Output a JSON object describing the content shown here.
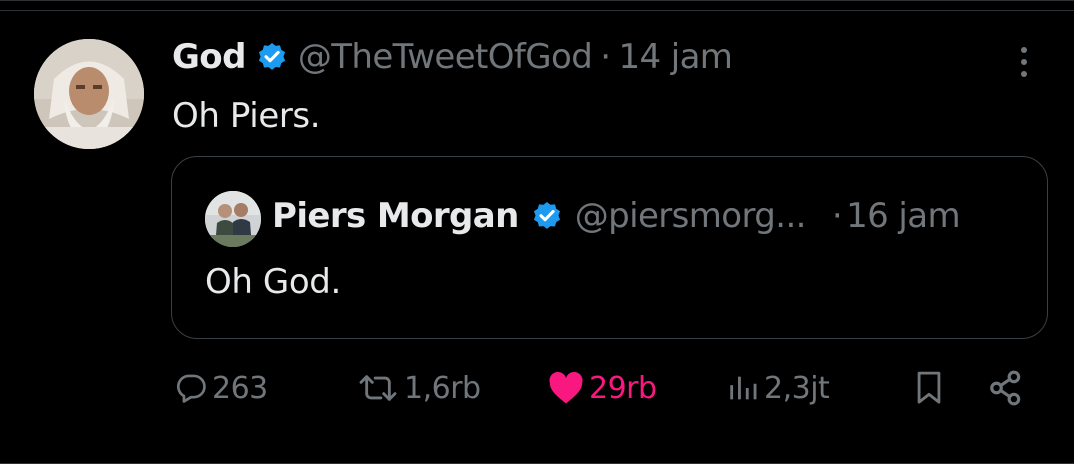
{
  "tweet": {
    "author_name": "God",
    "author_handle": "@TheTweetOfGod",
    "separator": "·",
    "time": "14 jam",
    "text": "Oh Piers.",
    "verified_color": "#1d9bf0"
  },
  "quoted_tweet": {
    "author_name": "Piers Morgan",
    "author_handle": "@piersmorg...",
    "separator": "·",
    "time": "16 jam",
    "text": "Oh God."
  },
  "actions": {
    "replies": "263",
    "reposts": "1,6rb",
    "likes": "29rb",
    "views": "2,3jt",
    "like_color": "#f91880"
  },
  "icons": [
    "verified-badge-icon",
    "more-options-icon",
    "reply-icon",
    "repost-icon",
    "like-icon",
    "views-icon",
    "bookmark-icon",
    "share-icon"
  ]
}
